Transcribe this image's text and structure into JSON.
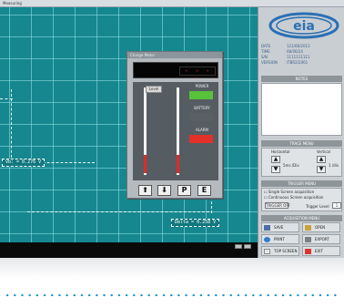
{
  "window": {
    "title": "Measuring"
  },
  "scope": {
    "channel_label": "Vb: = 0.276 V",
    "delta_label": "Delta = 0.258 V"
  },
  "meter": {
    "title": "Charge Meter",
    "display_value": "- - - -",
    "slider_label": "Level",
    "power_label": "POWER",
    "battery_label": "BATTERY",
    "alarm_label": "ALARM",
    "colors": {
      "power": "#57c23a",
      "battery": "#5a5f63",
      "alarm": "#e3312a"
    },
    "buttons": [
      "⬆",
      "⬇",
      "P",
      "E"
    ]
  },
  "panel": {
    "logo_text": "eia",
    "info": [
      {
        "key": "DATE",
        "value": "121/06/2013"
      },
      {
        "key": "TIME",
        "value": "08/06/24"
      },
      {
        "key": "S/N",
        "value": "1111111111"
      },
      {
        "key": "VERSION",
        "value": "ITBR2/2061"
      }
    ],
    "notes_header": "NOTES",
    "trace_header": "TRACE MENU",
    "horizontal_label": "Horizontal",
    "vertical_label": "Vertical",
    "horizontal_value": "5ms /Div",
    "vertical_value": "1 /div",
    "trigger_header": "TRIGGER MENU",
    "single_screen": "Single Screen acquisition",
    "continuous_screen": "Continuous Screen acquisition",
    "trigger_button": "TRIGGER OFF",
    "trigger_level_label": "Trigger Level",
    "trigger_level_value": "1",
    "acquisition_header": "ACQUISITION MENU",
    "actions": [
      "SAVE",
      "OPEN",
      "PRINT",
      "EXPORT",
      "TOP SCREEN",
      "EXIT"
    ]
  }
}
